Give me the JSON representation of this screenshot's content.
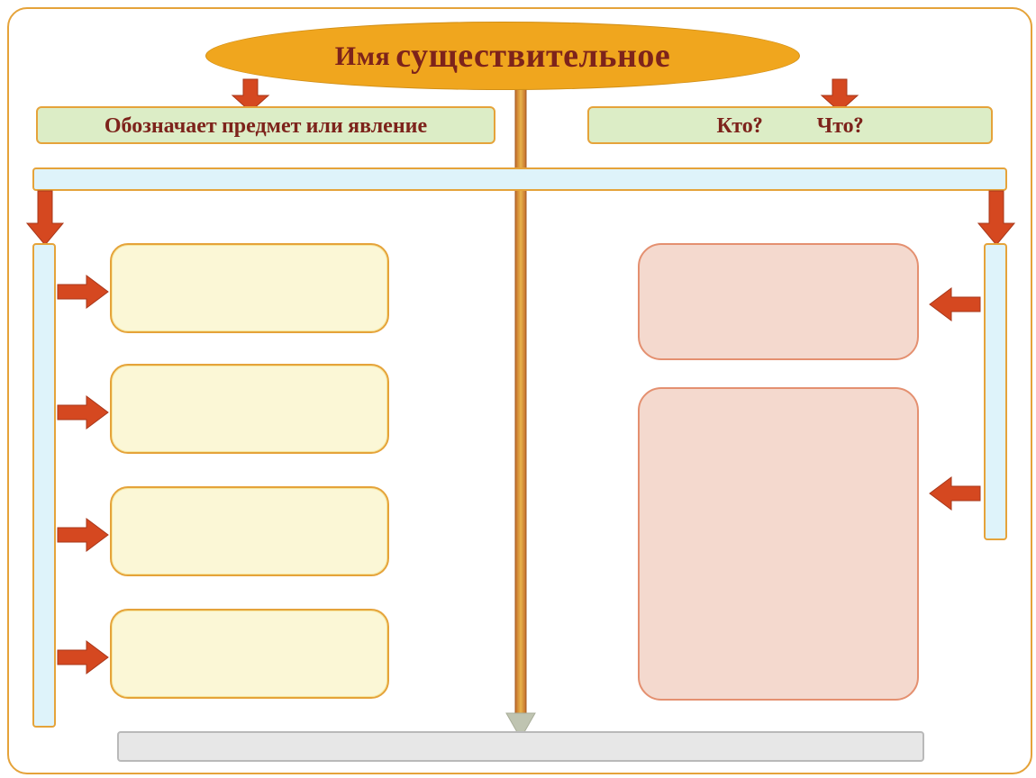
{
  "title": {
    "prefix": "Имя",
    "main": "существительное"
  },
  "left_green": "Обозначает предмет или явление",
  "right_green_q1": "Кто?",
  "right_green_q2": "Что?"
}
